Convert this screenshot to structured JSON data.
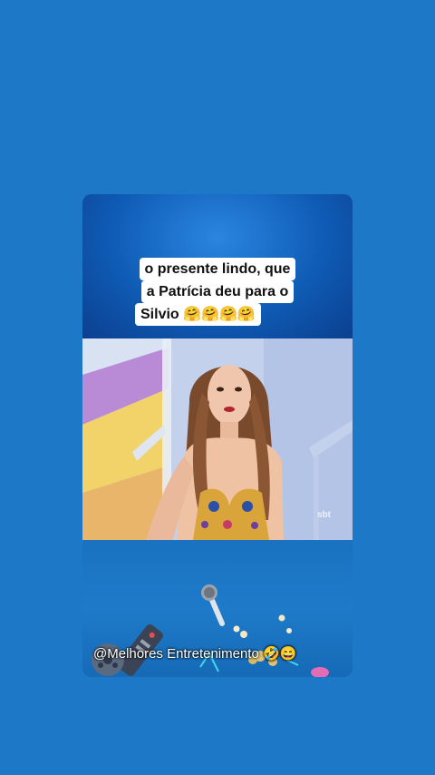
{
  "caption": {
    "line1": "o presente lindo, que",
    "line2": "a Patrícia deu para o",
    "line3": "Silvio 🤗🤗🤗🤗"
  },
  "video": {
    "channel_logo": "sbt"
  },
  "watermark": {
    "text": "@Melhores Entretenimento 🤣😄"
  },
  "colors": {
    "page_background": "#1e78c8",
    "panel_dark": "#0b3f8f",
    "panel_light": "#2a86e0"
  }
}
